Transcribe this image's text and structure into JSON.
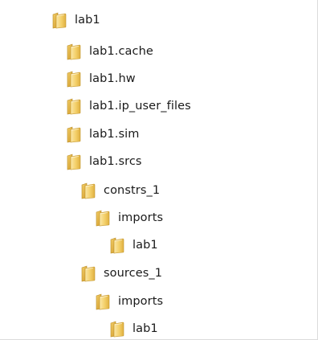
{
  "tree": {
    "nodes": [
      {
        "label": "lab1",
        "icon": "folder-icon"
      },
      {
        "label": "lab1.cache",
        "icon": "folder-icon"
      },
      {
        "label": "lab1.hw",
        "icon": "folder-icon"
      },
      {
        "label": "lab1.ip_user_files",
        "icon": "folder-icon"
      },
      {
        "label": "lab1.sim",
        "icon": "folder-icon"
      },
      {
        "label": "lab1.srcs",
        "icon": "folder-icon"
      },
      {
        "label": "constrs_1",
        "icon": "folder-icon"
      },
      {
        "label": "imports",
        "icon": "folder-icon"
      },
      {
        "label": "lab1",
        "icon": "folder-icon"
      },
      {
        "label": "sources_1",
        "icon": "folder-icon"
      },
      {
        "label": "imports",
        "icon": "folder-icon"
      },
      {
        "label": "lab1",
        "icon": "folder-icon"
      }
    ]
  },
  "colors": {
    "folder_light": "#f6d77a",
    "folder_dark": "#d8a93a",
    "folder_edge": "#b88a22"
  }
}
